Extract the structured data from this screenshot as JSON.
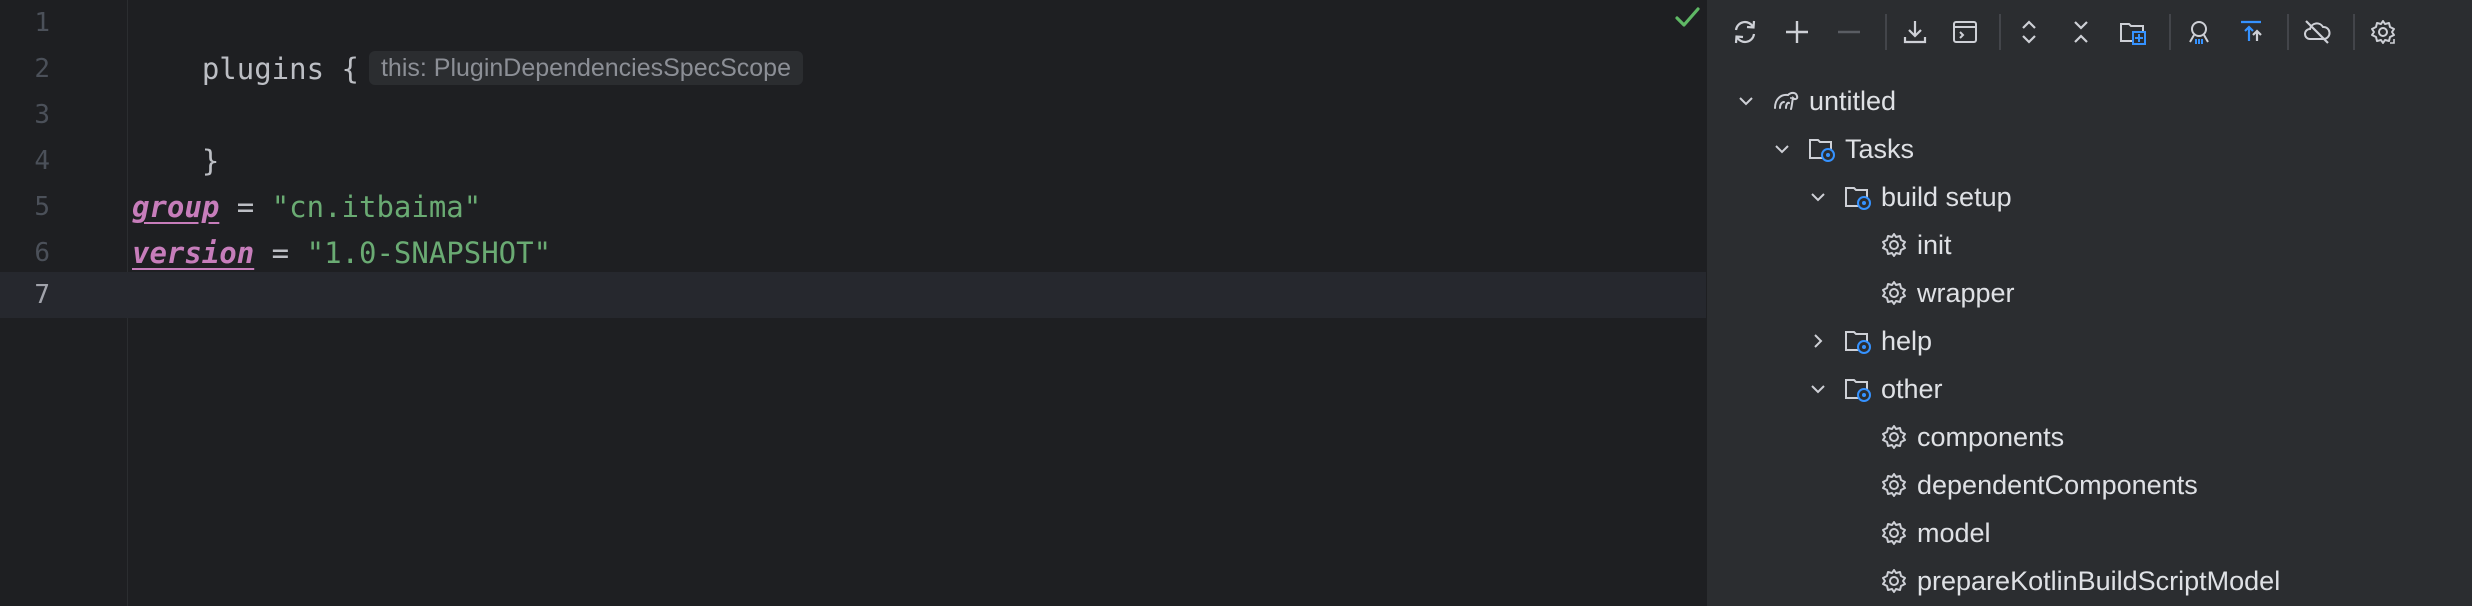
{
  "editor": {
    "lines": [
      {
        "num": "1",
        "code": "plugins {",
        "hint": "this: PluginDependenciesSpecScope"
      },
      {
        "num": "2"
      },
      {
        "num": "3",
        "code": "}"
      },
      {
        "num": "4"
      },
      {
        "num": "5",
        "prop": "group",
        "op": " = ",
        "value": "\"cn.itbaima\""
      },
      {
        "num": "6",
        "prop": "version",
        "op": " = ",
        "value": "\"1.0-SNAPSHOT\""
      },
      {
        "num": "7"
      }
    ],
    "active_line": "7"
  },
  "toolbar": {
    "icons": [
      "sync-icon",
      "plus-icon",
      "minus-icon",
      "download-icon",
      "terminal-icon",
      "expand-all-icon",
      "collapse-all-icon",
      "folder-link-icon",
      "dependency-analyzer-icon",
      "toggle-offline-icon",
      "offline-cloud-icon",
      "settings-icon"
    ]
  },
  "tree": {
    "root": {
      "label": "untitled",
      "icon": "gradle-elephant-icon"
    },
    "tasks": {
      "label": "Tasks"
    },
    "groups": [
      {
        "label": "build setup",
        "expanded": true,
        "tasks": [
          "init",
          "wrapper"
        ]
      },
      {
        "label": "help",
        "expanded": false,
        "tasks": []
      },
      {
        "label": "other",
        "expanded": true,
        "tasks": [
          "components",
          "dependentComponents",
          "model",
          "prepareKotlinBuildScriptModel"
        ]
      }
    ]
  },
  "colors": {
    "editor_bg": "#1e1f22",
    "panel_bg": "#2b2d30",
    "string": "#6aab73",
    "property": "#c77dbb",
    "accent_blue": "#3592ff",
    "check_green": "#5fb865"
  }
}
